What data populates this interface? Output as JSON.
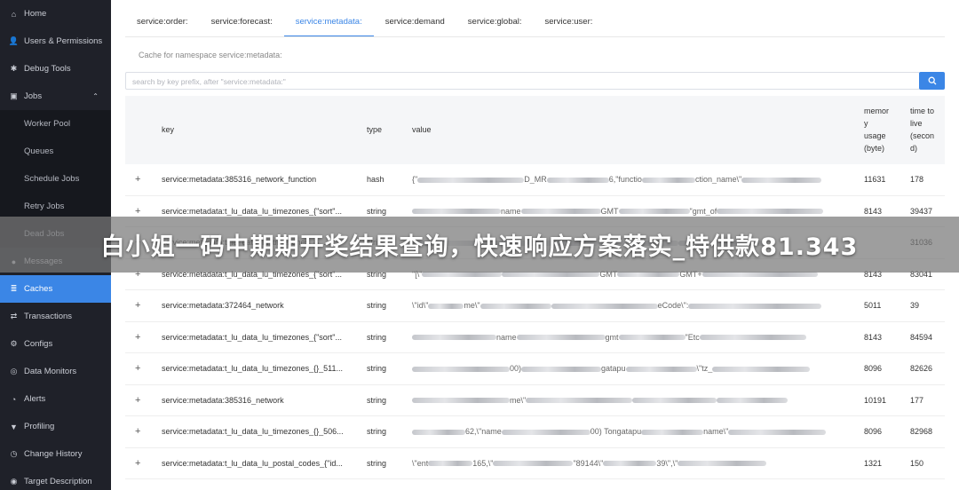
{
  "sidebar": {
    "items": [
      {
        "label": "Home",
        "icon": "home-icon",
        "glyph": "⌂"
      },
      {
        "label": "Users & Permissions",
        "icon": "user-icon",
        "glyph": "👤"
      },
      {
        "label": "Debug Tools",
        "icon": "bug-icon",
        "glyph": "✱"
      },
      {
        "label": "Jobs",
        "icon": "briefcase-icon",
        "glyph": "▣",
        "expanded": true
      },
      {
        "label": "Worker Pool",
        "sub": true
      },
      {
        "label": "Queues",
        "sub": true
      },
      {
        "label": "Schedule Jobs",
        "sub": true
      },
      {
        "label": "Retry Jobs",
        "sub": true
      },
      {
        "label": "Dead Jobs",
        "sub": true
      },
      {
        "label": "Messages",
        "icon": "message-icon",
        "glyph": "●"
      },
      {
        "label": "Caches",
        "icon": "layers-icon",
        "glyph": "≣",
        "active": true
      },
      {
        "label": "Transactions",
        "icon": "exchange-icon",
        "glyph": "⇄"
      },
      {
        "label": "Configs",
        "icon": "gear-icon",
        "glyph": "⚙"
      },
      {
        "label": "Data Monitors",
        "icon": "globe-icon",
        "glyph": "◎"
      },
      {
        "label": "Alerts",
        "icon": "bell-icon",
        "glyph": "◔"
      },
      {
        "label": "Profiling",
        "icon": "funnel-icon",
        "glyph": "▼"
      },
      {
        "label": "Change History",
        "icon": "history-icon",
        "glyph": "◷"
      },
      {
        "label": "Target Description",
        "icon": "target-icon",
        "glyph": "◉"
      }
    ],
    "caret": "⌃"
  },
  "tabs": [
    {
      "label": "service:order:"
    },
    {
      "label": "service:forecast:"
    },
    {
      "label": "service:metadata:",
      "active": true
    },
    {
      "label": "service:demand"
    },
    {
      "label": "service:global:"
    },
    {
      "label": "service:user:"
    }
  ],
  "caption": "Cache for namespace service:metadata:",
  "search": {
    "placeholder": "search by key prefix, after \"service:metadata:\""
  },
  "table": {
    "headers": {
      "key": "key",
      "type": "type",
      "value": "value",
      "memory": [
        "memor",
        "y",
        "usage",
        "(byte)"
      ],
      "ttl": [
        "time to",
        "live",
        "(secon",
        "d)"
      ]
    },
    "expand_symbol": "+",
    "rows": [
      {
        "key": "service:metadata:385316_network_function",
        "type": "hash",
        "value_start": "{\"",
        "value_mid": "D_MR",
        "value_end": "6,\"functio",
        "value_tail": "ction_name\\\"",
        "memory": "11631",
        "ttl": "178"
      },
      {
        "key": "service:metadata:t_lu_data_lu_timezones_{\"sort\"...",
        "type": "string",
        "value_start": "",
        "value_mid": "name",
        "value_end": "GMT",
        "value_tail": "\"gmt_of",
        "memory": "8143",
        "ttl": "39437"
      },
      {
        "key": "service:metadata:t_lu_data_lu_timezones_{}_...",
        "type": "string",
        "value_start": "",
        "value_mid": "",
        "value_end": "",
        "value_tail": "",
        "memory": "",
        "ttl": "31036"
      },
      {
        "key": "service:metadata:t_lu_data_lu_timezones_{\"sort\"...",
        "type": "string",
        "value_start": "\"[\\\"",
        "value_mid": "",
        "value_end": "GMT",
        "value_tail": "GMT+",
        "memory": "8143",
        "ttl": "83041"
      },
      {
        "key": "service:metadata:372464_network",
        "type": "string",
        "value_start": "\\\"id\\\"",
        "value_mid": "me\\\"",
        "value_end": "",
        "value_tail": "eCode\\\":",
        "memory": "5011",
        "ttl": "39"
      },
      {
        "key": "service:metadata:t_lu_data_lu_timezones_{\"sort\"...",
        "type": "string",
        "value_start": "",
        "value_mid": "name",
        "value_end": "gmt",
        "value_tail": "\"Etc",
        "memory": "8143",
        "ttl": "84594"
      },
      {
        "key": "service:metadata:t_lu_data_lu_timezones_{}_511...",
        "type": "string",
        "value_start": "",
        "value_mid": "00)",
        "value_end": "gatapu",
        "value_tail": "\\\"tz_",
        "memory": "8096",
        "ttl": "82626"
      },
      {
        "key": "service:metadata:385316_network",
        "type": "string",
        "value_start": "",
        "value_mid": "me\\\"",
        "value_end": "",
        "value_tail": "",
        "memory": "10191",
        "ttl": "177"
      },
      {
        "key": "service:metadata:t_lu_data_lu_timezones_{}_506...",
        "type": "string",
        "value_start": "",
        "value_mid": "62,\\\"name",
        "value_end": "00)  Tongatapu",
        "value_tail": "name\\\"",
        "memory": "8096",
        "ttl": "82968"
      },
      {
        "key": "service:metadata:t_lu_data_lu_postal_codes_{\"id...",
        "type": "string",
        "value_start": "\\\"ent",
        "value_mid": "165,\\\"",
        "value_end": "\"89144\\\"",
        "value_tail": "39\\\",\\\"",
        "memory": "1321",
        "ttl": "150"
      }
    ]
  },
  "banner": {
    "text": "白小姐一码中期期开奖结果查询，快速响应方案落实_特供款81.343"
  },
  "colors": {
    "accent": "#3b86e6",
    "sidebar_bg": "#1f2129",
    "sidebar_sub_bg": "#16181e"
  }
}
